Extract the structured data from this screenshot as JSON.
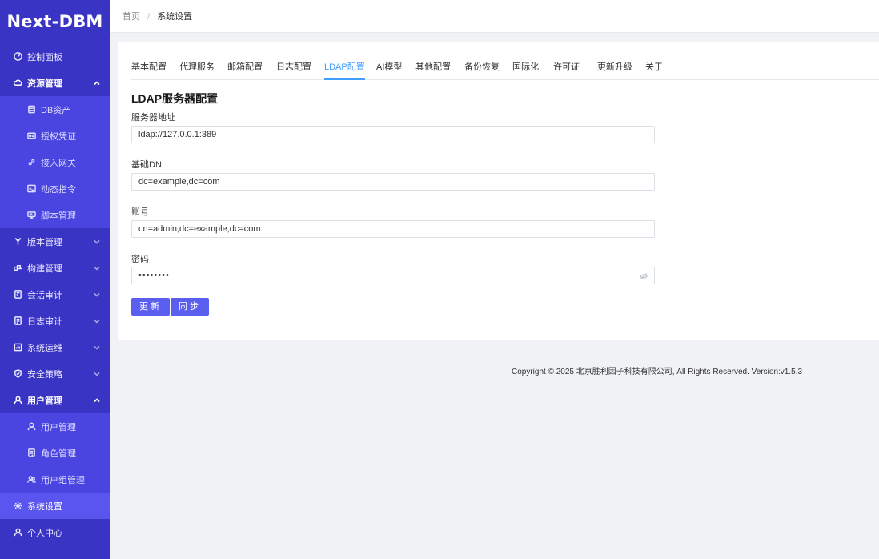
{
  "app": {
    "logo": "Next-DBM"
  },
  "sidebar": {
    "items": [
      {
        "label": "控制面板",
        "icon": "dashboard-icon"
      },
      {
        "label": "资源管理",
        "icon": "cloud-icon",
        "expanded": true
      },
      {
        "label": "DB资产",
        "icon": "database-icon"
      },
      {
        "label": "授权凭证",
        "icon": "credential-icon"
      },
      {
        "label": "接入网关",
        "icon": "link-icon"
      },
      {
        "label": "动态指令",
        "icon": "terminal-icon"
      },
      {
        "label": "脚本管理",
        "icon": "script-icon"
      },
      {
        "label": "版本管理",
        "icon": "branch-icon"
      },
      {
        "label": "构建管理",
        "icon": "build-icon"
      },
      {
        "label": "会话审计",
        "icon": "audit-icon"
      },
      {
        "label": "日志审计",
        "icon": "log-icon"
      },
      {
        "label": "系统运维",
        "icon": "ops-icon"
      },
      {
        "label": "安全策略",
        "icon": "shield-icon"
      },
      {
        "label": "用户管理",
        "icon": "user-icon",
        "expanded": true
      },
      {
        "label": "用户管理",
        "icon": "user-icon"
      },
      {
        "label": "角色管理",
        "icon": "role-icon"
      },
      {
        "label": "用户组管理",
        "icon": "group-icon"
      },
      {
        "label": "系统设置",
        "icon": "gear-icon",
        "active": true
      },
      {
        "label": "个人中心",
        "icon": "person-icon"
      }
    ]
  },
  "breadcrumb": {
    "home": "首页",
    "separator": "/",
    "current": "系统设置"
  },
  "tabs": [
    "基本配置",
    "代理服务",
    "邮箱配置",
    "日志配置",
    "LDAP配置",
    "AI模型",
    "其他配置",
    "备份恢复",
    "国际化",
    "许可证",
    "更新升级",
    "关于"
  ],
  "active_tab": "LDAP配置",
  "form": {
    "title": "LDAP服务器配置",
    "server_label": "服务器地址",
    "server_value": "ldap://127.0.0.1:389",
    "basedn_label": "基础DN",
    "basedn_value": "dc=example,dc=com",
    "account_label": "账号",
    "account_value": "cn=admin,dc=example,dc=com",
    "password_label": "密码",
    "password_mask": "••••••••",
    "update_button": "更新",
    "sync_button": "同步"
  },
  "footer": {
    "text": "Copyright © 2025 北京胜利因子科技有限公司, All Rights Reserved. Version:v1.5.3"
  },
  "colors": {
    "sidebar_bg": "#3a34c5",
    "submenu_bg": "#4a44e0",
    "active_item": "#5a55ee",
    "primary_button": "#5a5ff0",
    "active_tab": "#409eff"
  }
}
